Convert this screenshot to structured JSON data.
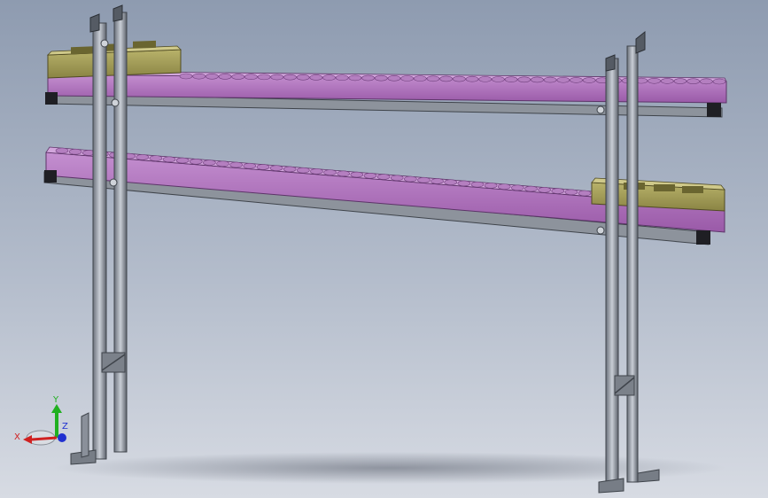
{
  "viewport": {
    "background_top": "#8e9bb0",
    "background_bottom": "#d7dbe3"
  },
  "model": {
    "description_icons": [
      "conveyor-rollers",
      "tote-bin",
      "aluminum-frame"
    ],
    "colors": {
      "conveyor": "#a56cb2",
      "conveyor_dark": "#6f3f7c",
      "frame": "#9aa0aa",
      "frame_dark": "#4a4f57",
      "tote": "#9b9553",
      "tote_dark": "#5f5a2c"
    }
  },
  "triad": {
    "x_label": "X",
    "y_label": "Y",
    "z_label": "Z",
    "x_color": "#d02020",
    "y_color": "#20b020",
    "z_color": "#2030d0"
  }
}
